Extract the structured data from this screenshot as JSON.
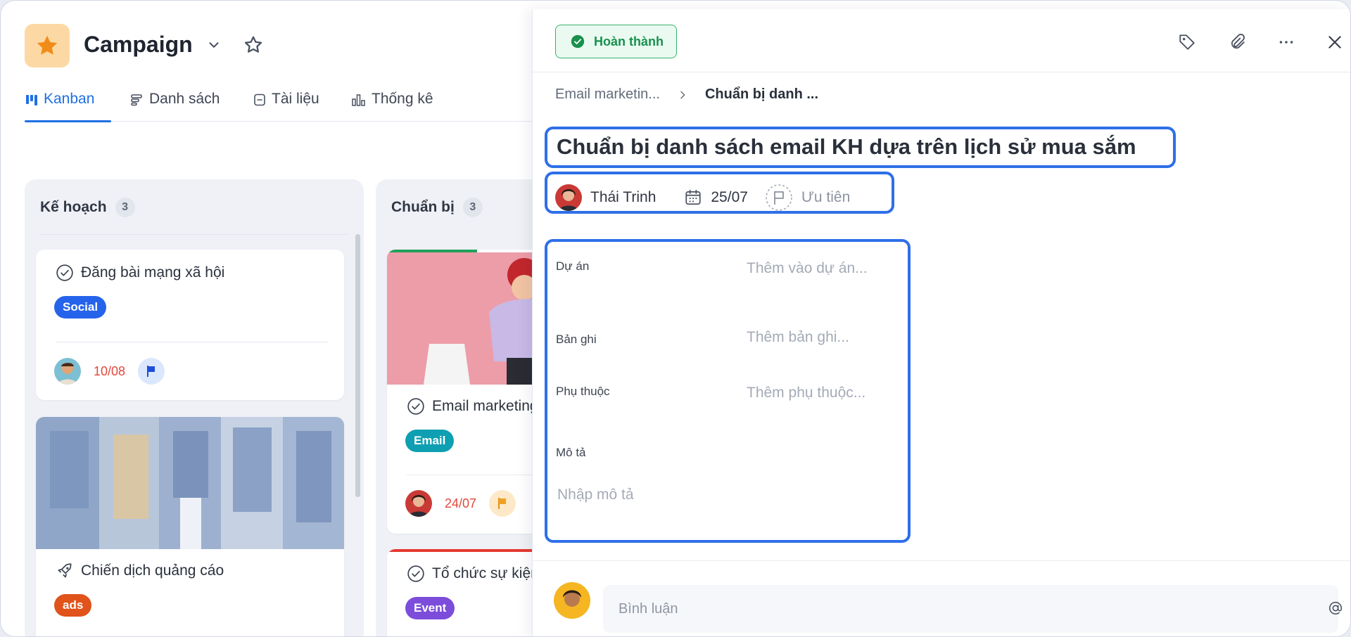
{
  "project": {
    "title": "Campaign"
  },
  "view_tabs": [
    {
      "label": "Kanban",
      "icon": "kanban-icon",
      "active": true
    },
    {
      "label": "Danh sách",
      "icon": "list-icon",
      "active": false
    },
    {
      "label": "Tài liệu",
      "icon": "document-icon",
      "active": false
    },
    {
      "label": "Thống kê",
      "icon": "bar-chart-icon",
      "active": false
    }
  ],
  "columns": [
    {
      "title": "Kế hoạch",
      "count": "3",
      "cards": [
        {
          "title": "Đăng bài mạng xã hội",
          "tag": "Social",
          "tag_color": "#2563eb",
          "due": "10/08",
          "flag_color": "#1d4ed8"
        },
        {
          "title": "Chiến dịch quảng cáo",
          "tag": "ads",
          "tag_color": "#e0531a"
        }
      ]
    },
    {
      "title": "Chuẩn bị",
      "count": "3",
      "cards": [
        {
          "title": "Email marketing",
          "tag": "Email",
          "tag_color": "#0e9fb2",
          "due": "24/07",
          "flag_color": "#f0a020",
          "progress": 0.3
        },
        {
          "title": "Tổ chức sự kiện",
          "tag": "Event",
          "tag_color": "#7c4ddb"
        }
      ]
    }
  ],
  "panel": {
    "status": "Hoàn thành",
    "status_color": "#18914c",
    "breadcrumb": [
      "Email marketin...",
      "Chuẩn bị danh ..."
    ],
    "task_title": "Chuẩn bị danh sách email KH dựa trên lịch sử mua sắm",
    "assignee": "Thái Trinh",
    "due_date": "25/07",
    "priority": "Ưu tiên",
    "props": [
      {
        "label": "Dự án",
        "value": "Thêm vào dự án..."
      },
      {
        "label": "Bản ghi",
        "value": "Thêm bản ghi..."
      },
      {
        "label": "Phụ thuộc",
        "value": "Thêm phụ thuộc..."
      },
      {
        "label": "Mô tả",
        "value": ""
      }
    ],
    "description_placeholder": "Nhập mô tả",
    "comment_placeholder": "Bình luận"
  },
  "colors": {
    "accent": "#1f6fe5",
    "focus_outline": "#2f6fe8",
    "due_red": "#e2473b"
  }
}
